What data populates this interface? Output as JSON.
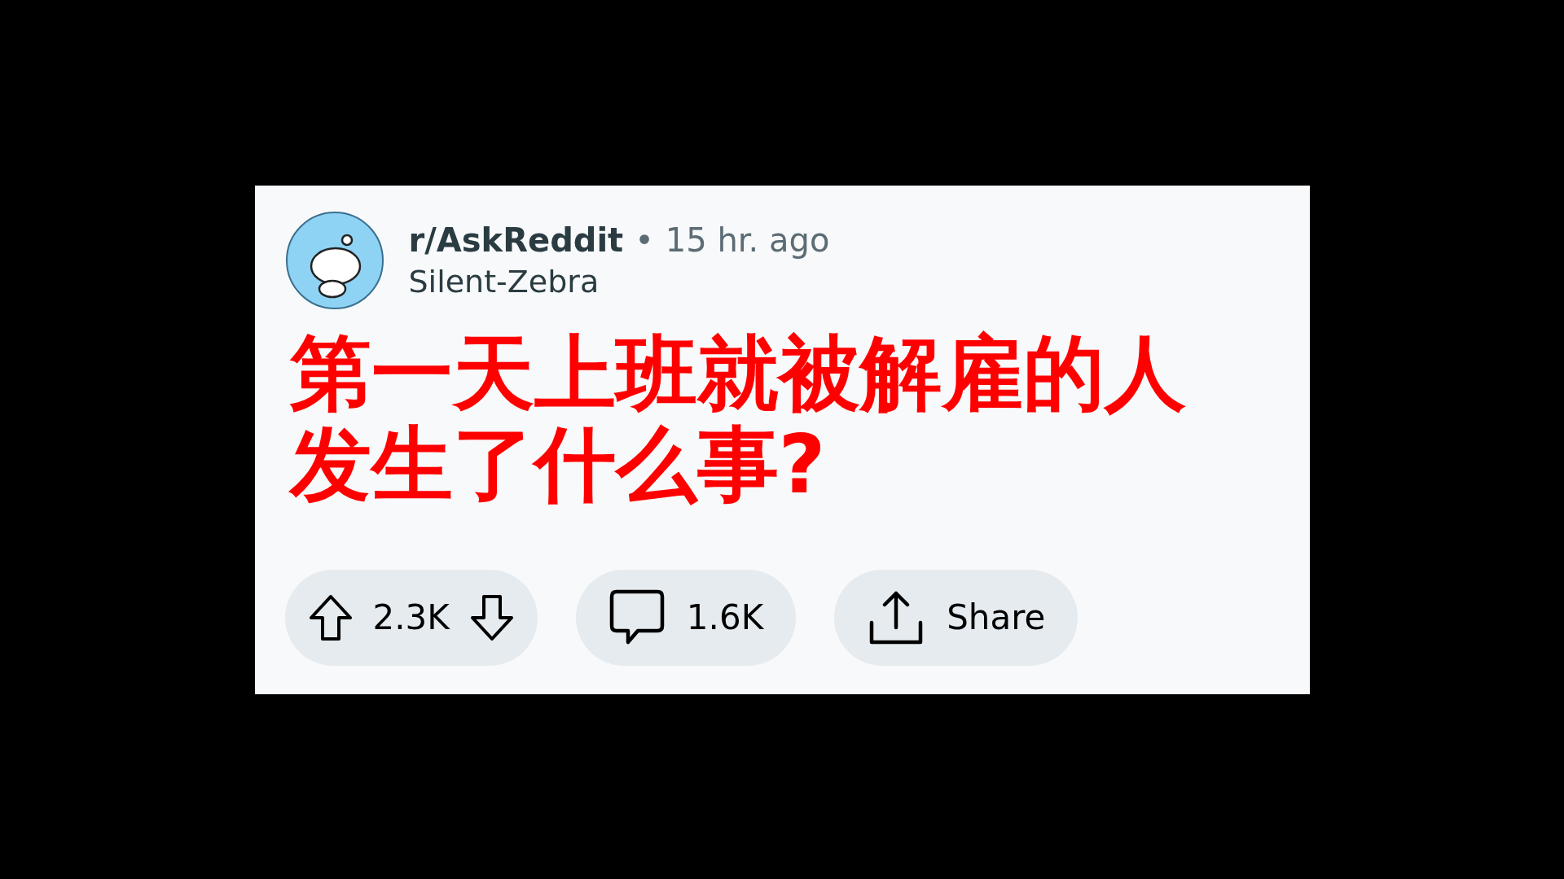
{
  "post": {
    "subreddit": "r/AskReddit",
    "separator": "•",
    "time": "15 hr. ago",
    "author": "Silent-Zebra",
    "title": "第一天上班就被解雇的人发生了什么事?"
  },
  "actions": [
    {
      "kind": "vote",
      "count": "2.3K"
    },
    {
      "kind": "comment",
      "count": "1.6K"
    },
    {
      "kind": "share",
      "label": "Share"
    }
  ]
}
